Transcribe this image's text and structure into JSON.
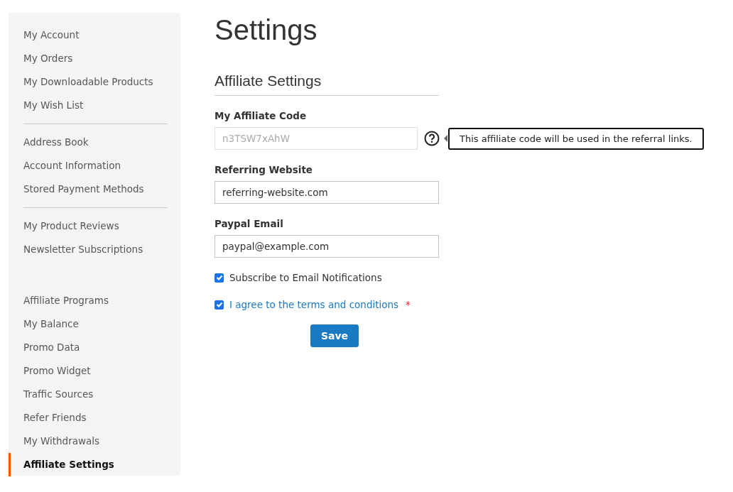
{
  "sidebar": {
    "groups": [
      {
        "items": [
          {
            "label": "My Account",
            "selected": false
          },
          {
            "label": "My Orders",
            "selected": false
          },
          {
            "label": "My Downloadable Products",
            "selected": false
          },
          {
            "label": "My Wish List",
            "selected": false
          }
        ]
      },
      {
        "items": [
          {
            "label": "Address Book",
            "selected": false
          },
          {
            "label": "Account Information",
            "selected": false
          },
          {
            "label": "Stored Payment Methods",
            "selected": false
          }
        ]
      },
      {
        "items": [
          {
            "label": "My Product Reviews",
            "selected": false
          },
          {
            "label": "Newsletter Subscriptions",
            "selected": false
          }
        ]
      },
      {
        "items": [
          {
            "label": "Affiliate Programs",
            "selected": false
          },
          {
            "label": "My Balance",
            "selected": false
          },
          {
            "label": "Promo Data",
            "selected": false
          },
          {
            "label": "Promo Widget",
            "selected": false
          },
          {
            "label": "Traffic Sources",
            "selected": false
          },
          {
            "label": "Refer Friends",
            "selected": false
          },
          {
            "label": "My Withdrawals",
            "selected": false
          },
          {
            "label": "Affiliate Settings",
            "selected": true
          }
        ]
      }
    ]
  },
  "page_title": "Settings",
  "section_title": "Affiliate Settings",
  "fields": [
    {
      "label": "My Affiliate Code",
      "value": "n3TSW7xAhW",
      "disabled": true,
      "tooltip": "This affiliate code will be used in the referral links."
    },
    {
      "label": "Referring Website",
      "value": "referring-website.com",
      "disabled": false
    },
    {
      "label": "Paypal Email",
      "value": "paypal@example.com",
      "disabled": false
    }
  ],
  "checkboxes": [
    {
      "label": "Subscribe to Email Notifications",
      "checked": true,
      "kind": "plain"
    },
    {
      "label": "I agree to the terms and conditions",
      "checked": true,
      "kind": "link",
      "required_mark": "*"
    }
  ],
  "save_button": "Save"
}
